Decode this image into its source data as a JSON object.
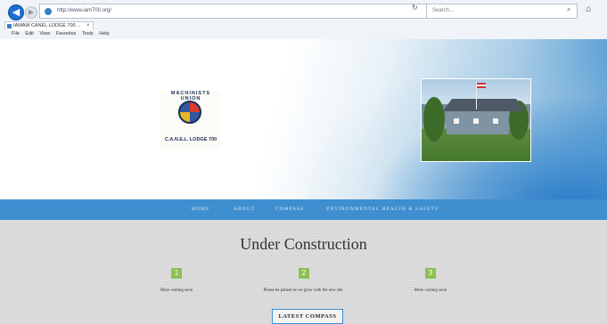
{
  "browser": {
    "address_url": "http://www.iam700.org/",
    "search_placeholder": "Search...",
    "tab_title": "IAMAW CANEL LODGE 700 ...",
    "tab_close": "×",
    "menu": [
      "File",
      "Edit",
      "View",
      "Favorites",
      "Tools",
      "Help"
    ]
  },
  "header": {
    "logo_arc_text": "MACHINISTS UNION",
    "logo_caption": "C.A.N.E.L. LODGE 700"
  },
  "nav": {
    "items": [
      "HOME",
      "ABOUT",
      "COMPASS",
      "ENVIRONMENTAL HEALTH & SAFETY"
    ]
  },
  "content": {
    "title": "Under Construction",
    "steps": [
      {
        "number": "1",
        "text": "More coming soon"
      },
      {
        "number": "2",
        "text": "Please be patient as we grow with the new site"
      },
      {
        "number": "3",
        "text": "More coming soon"
      }
    ],
    "button_label": "LATEST COMPASS"
  },
  "colors": {
    "nav_bar": "#3f8fd0",
    "step_badge": "#8cc152",
    "button_border": "#3f8fd0"
  }
}
